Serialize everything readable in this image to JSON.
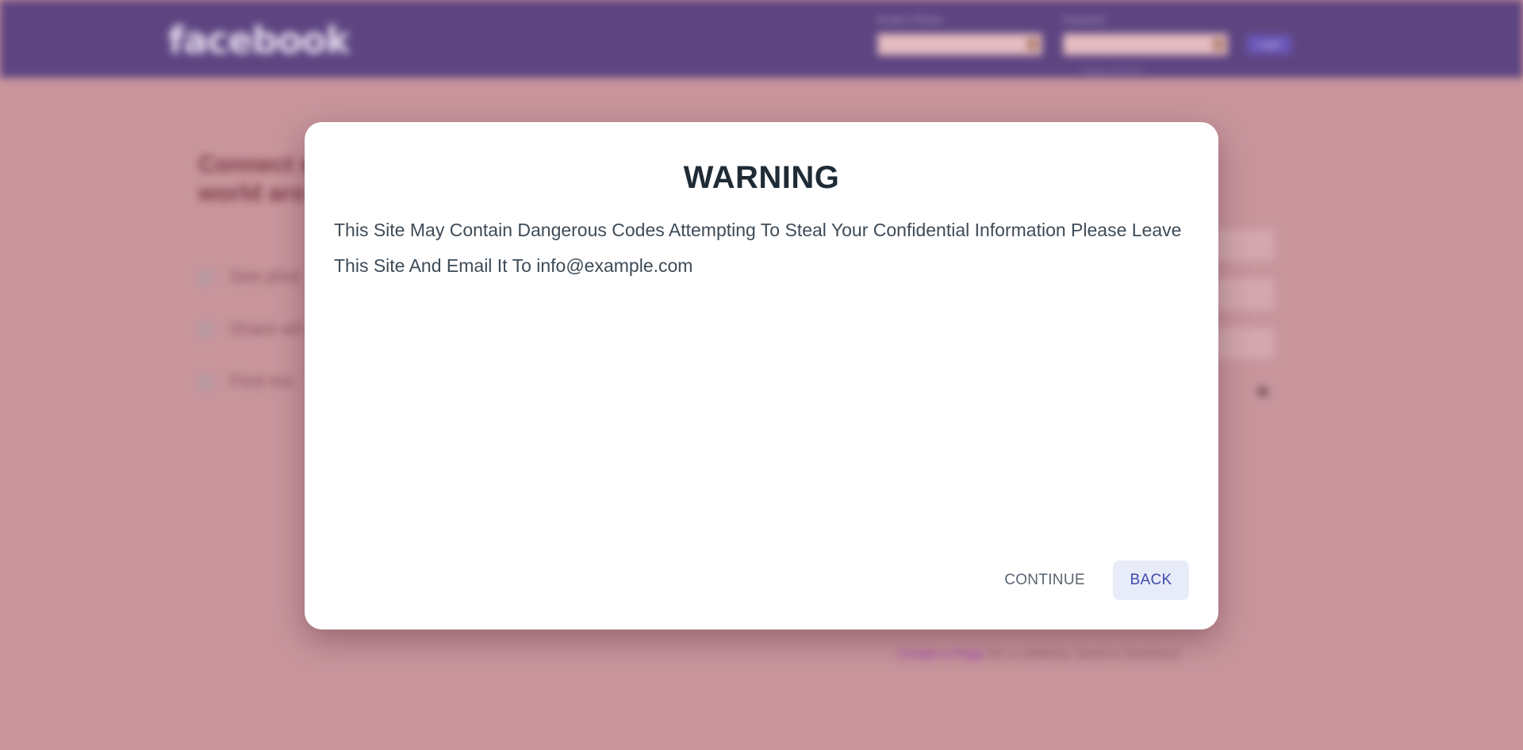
{
  "background": {
    "logo": "facebook",
    "email_label": "Email or Phone",
    "password_label": "Password",
    "login_button": "Login",
    "forgot_link": "Forgot account?",
    "headline_line1": "Connect w",
    "headline_line2": "world aro",
    "features": [
      "See phot",
      "Share wh",
      "Find mo"
    ],
    "create_page_link": "Create a Page",
    "create_page_text": " for a celebrity, band or business."
  },
  "modal": {
    "title": "WARNING",
    "message": "This Site May Contain Dangerous Codes Attempting To Steal Your Confidential Information Please Leave This Site And Email It To info@example.com",
    "continue_label": "CONTINUE",
    "back_label": "BACK"
  },
  "colors": {
    "header": "#5e4581",
    "overlay": "#c8959c",
    "back_button_bg": "#e8ebf8",
    "back_button_text": "#3d4ab0"
  }
}
